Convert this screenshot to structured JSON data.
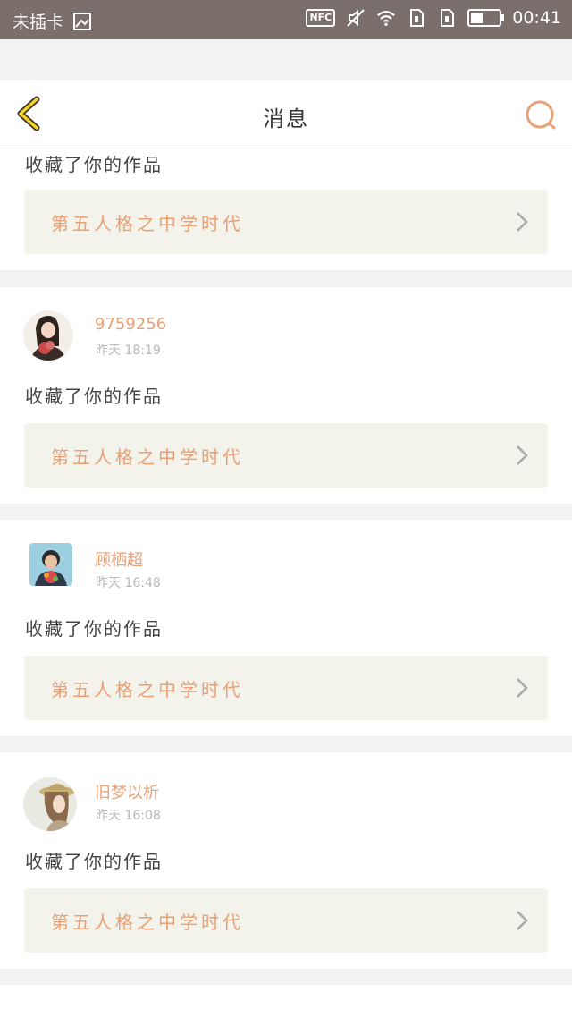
{
  "status_bar": {
    "carrier": "未插卡",
    "nfc_label": "NFC",
    "time": "00:41",
    "battery_level": 0.4
  },
  "nav": {
    "title": "消息"
  },
  "notifications": [
    {
      "username": "",
      "time": "",
      "action": "收藏了你的作品",
      "work_title": "第五人格之中学时代"
    },
    {
      "username": "9759256",
      "time": "昨天 18:19",
      "action": "收藏了你的作品",
      "work_title": "第五人格之中学时代"
    },
    {
      "username": "顾栖超",
      "time": "昨天 16:48",
      "action": "收藏了你的作品",
      "work_title": "第五人格之中学时代"
    },
    {
      "username": "旧梦以析",
      "time": "昨天 16:08",
      "action": "收藏了你的作品",
      "work_title": "第五人格之中学时代"
    }
  ],
  "colors": {
    "accent": "#e8a074",
    "back_icon": "#f2d21c",
    "status_bar": "#7b6f6b",
    "card_link_bg": "#f3f3ec"
  },
  "icons": [
    "back-arrow-icon",
    "search-icon",
    "chevron-right-icon",
    "wifi-icon",
    "mute-icon",
    "image-icon",
    "sim-icon",
    "battery-icon"
  ]
}
